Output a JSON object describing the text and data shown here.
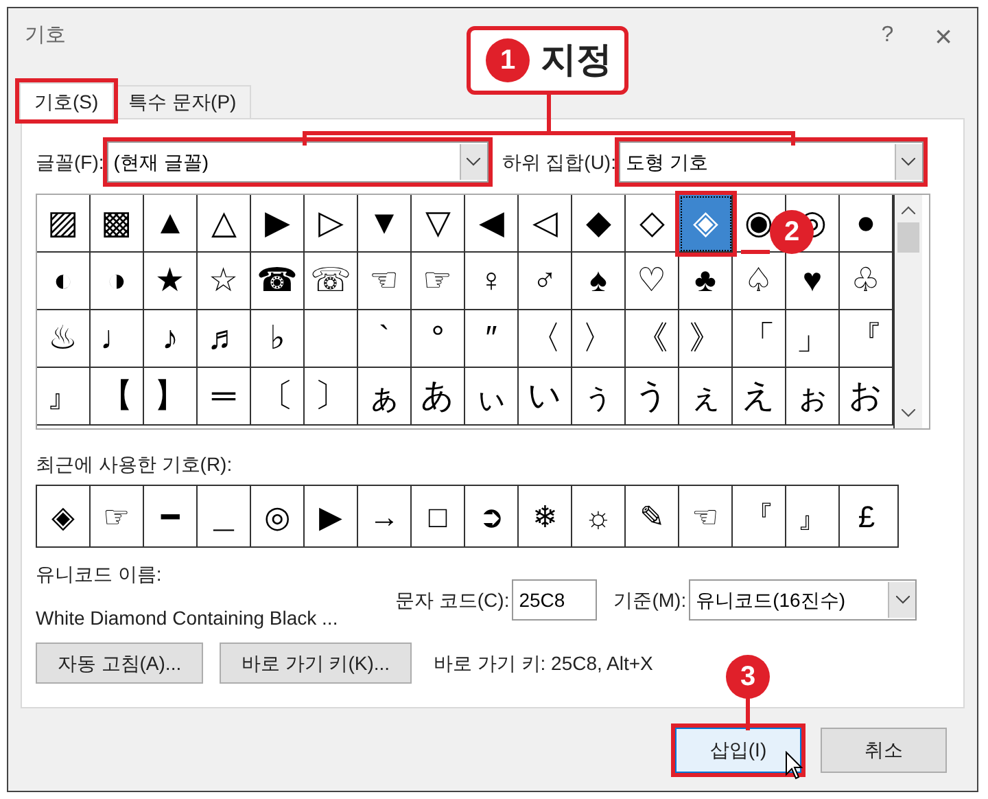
{
  "window": {
    "title": "기호",
    "help": "?",
    "close": "×"
  },
  "tabs": [
    {
      "label": "기호(S)",
      "selected": true,
      "highlighted": true
    },
    {
      "label": "특수 문자(P)",
      "selected": false,
      "highlighted": false
    }
  ],
  "font": {
    "label": "글꼴(F):",
    "value": "(현재 글꼴)",
    "highlighted": true
  },
  "subset": {
    "label": "하위 집합(U):",
    "value": "도형 기호",
    "highlighted": true
  },
  "symbol_grid": {
    "rows": [
      [
        {
          "glyph": "▨",
          "selected": false
        },
        {
          "glyph": "▩",
          "selected": false
        },
        {
          "glyph": "▲",
          "selected": false
        },
        {
          "glyph": "△",
          "selected": false
        },
        {
          "glyph": "▶",
          "selected": false
        },
        {
          "glyph": "▷",
          "selected": false
        },
        {
          "glyph": "▼",
          "selected": false
        },
        {
          "glyph": "▽",
          "selected": false
        },
        {
          "glyph": "◀",
          "selected": false
        },
        {
          "glyph": "◁",
          "selected": false
        },
        {
          "glyph": "◆",
          "selected": false
        },
        {
          "glyph": "◇",
          "selected": false
        },
        {
          "glyph": "◈",
          "selected": true
        },
        {
          "glyph": "◉",
          "selected": false
        },
        {
          "glyph": "◎",
          "selected": false
        },
        {
          "glyph": "●",
          "selected": false
        }
      ],
      [
        {
          "glyph": "◐",
          "selected": false
        },
        {
          "glyph": "◑",
          "selected": false
        },
        {
          "glyph": "★",
          "selected": false
        },
        {
          "glyph": "☆",
          "selected": false
        },
        {
          "glyph": "☎",
          "selected": false
        },
        {
          "glyph": "☏",
          "selected": false
        },
        {
          "glyph": "☜",
          "selected": false
        },
        {
          "glyph": "☞",
          "selected": false
        },
        {
          "glyph": "♀",
          "selected": false
        },
        {
          "glyph": "♂",
          "selected": false
        },
        {
          "glyph": "♠",
          "selected": false
        },
        {
          "glyph": "♡",
          "selected": false
        },
        {
          "glyph": "♣",
          "selected": false
        },
        {
          "glyph": "♤",
          "selected": false
        },
        {
          "glyph": "♥",
          "selected": false
        },
        {
          "glyph": "♧",
          "selected": false
        }
      ],
      [
        {
          "glyph": "♨",
          "selected": false
        },
        {
          "glyph": "♩",
          "selected": false
        },
        {
          "glyph": "♪",
          "selected": false
        },
        {
          "glyph": "♬",
          "selected": false
        },
        {
          "glyph": "♭",
          "selected": false
        },
        {
          "selected": false
        },
        {
          "glyph": "`",
          "selected": false
        },
        {
          "glyph": "°",
          "selected": false
        },
        {
          "glyph": "″",
          "selected": false
        },
        {
          "glyph": "〈",
          "selected": false
        },
        {
          "glyph": "〉",
          "selected": false
        },
        {
          "glyph": "《",
          "selected": false
        },
        {
          "glyph": "》",
          "selected": false
        },
        {
          "glyph": "「",
          "selected": false
        },
        {
          "glyph": "」",
          "selected": false
        },
        {
          "glyph": "『",
          "selected": false
        }
      ],
      [
        {
          "glyph": "』",
          "selected": false
        },
        {
          "glyph": "【",
          "selected": false
        },
        {
          "glyph": "】",
          "selected": false
        },
        {
          "glyph": "═",
          "selected": false
        },
        {
          "glyph": "〔",
          "selected": false
        },
        {
          "glyph": "〕",
          "selected": false
        },
        {
          "glyph": "ぁ",
          "selected": false
        },
        {
          "glyph": "あ",
          "selected": false
        },
        {
          "glyph": "ぃ",
          "selected": false
        },
        {
          "glyph": "い",
          "selected": false
        },
        {
          "glyph": "ぅ",
          "selected": false
        },
        {
          "glyph": "う",
          "selected": false
        },
        {
          "glyph": "ぇ",
          "selected": false
        },
        {
          "glyph": "え",
          "selected": false
        },
        {
          "glyph": "ぉ",
          "selected": false
        },
        {
          "glyph": "お",
          "selected": false
        }
      ]
    ]
  },
  "recent_symbols": {
    "label": "최근에 사용한 기호(R):",
    "symbols": [
      "◈",
      "☞",
      "━",
      "＿",
      "◎",
      "▶",
      "→",
      "□",
      "➲",
      "❄",
      "☼",
      "✎",
      "☜",
      "『",
      "』",
      "£"
    ]
  },
  "unicode_name": {
    "label": "유니코드 이름:",
    "value": "White Diamond Containing Black ..."
  },
  "character_code": {
    "label": "문자 코드(C):",
    "value": "25C8"
  },
  "from": {
    "label": "기준(M):",
    "value": "유니코드(16진수)"
  },
  "autocorrect_button": "자동 고침(A)...",
  "shortcut_key_button": "바로 가기 키(K)...",
  "shortcut_text": "바로 가기 키: 25C8, Alt+X",
  "dialog_buttons": [
    {
      "label": "삽입(I)",
      "hovered": true,
      "highlighted": true
    },
    {
      "label": "취소",
      "hovered": false,
      "highlighted": false
    }
  ],
  "annotations": [
    {
      "number": "1",
      "label": "지정"
    },
    {
      "number": "2"
    },
    {
      "number": "3"
    }
  ]
}
